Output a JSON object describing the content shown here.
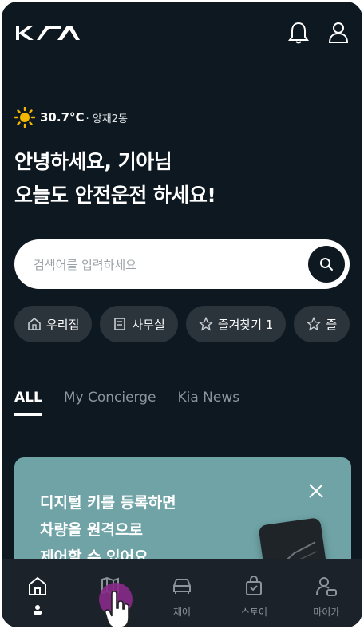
{
  "header": {
    "logo_text": "KIA",
    "bell_icon": "bell-icon",
    "profile_icon": "user-icon"
  },
  "weather": {
    "icon": "sun-icon",
    "temperature": "30.7°C",
    "location": "· 양재2동"
  },
  "greeting": {
    "line1": "안녕하세요, 기아님",
    "line2": "오늘도 안전운전 하세요!"
  },
  "search": {
    "placeholder": "검색어를 입력하세요",
    "value": ""
  },
  "quick_places": [
    {
      "icon": "home-icon",
      "label": "우리집"
    },
    {
      "icon": "building-icon",
      "label": "사무실"
    },
    {
      "icon": "star-icon",
      "label": "즐겨찾기 1"
    },
    {
      "icon": "star-icon",
      "label": "즐"
    }
  ],
  "tabs": [
    {
      "label": "ALL",
      "active": true
    },
    {
      "label": "My Concierge",
      "active": false
    },
    {
      "label": "Kia News",
      "active": false
    }
  ],
  "promo_card": {
    "line1": "디지털 키를 등록하면",
    "line2": "차량을 원격으로",
    "line3": "제어할 수 있어요",
    "close_icon": "close-icon"
  },
  "bottom_nav": [
    {
      "icon": "home-icon",
      "label": ""
    },
    {
      "icon": "map-icon",
      "label": ""
    },
    {
      "icon": "car-icon",
      "label": "제어"
    },
    {
      "icon": "shopping-bag-icon",
      "label": "스토어"
    },
    {
      "icon": "user-settings-icon",
      "label": "마이카"
    }
  ],
  "colors": {
    "background": "#0e1820",
    "chip": "#2c343b",
    "card": "#6fa3a6",
    "navbar": "#1b2229"
  }
}
